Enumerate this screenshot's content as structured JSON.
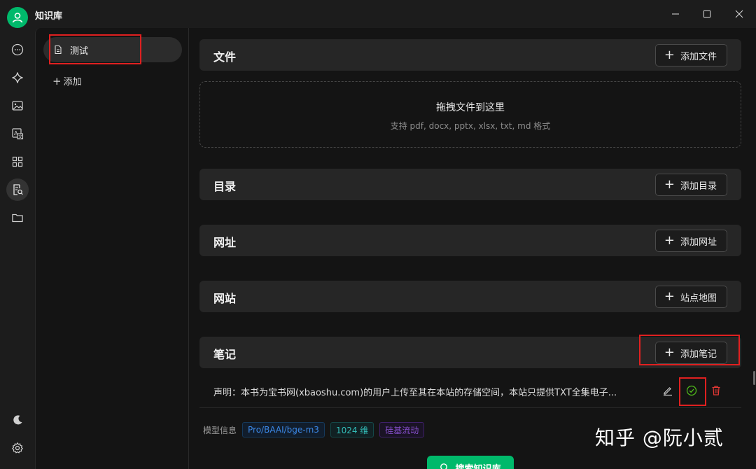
{
  "window": {
    "title": "知识库"
  },
  "rail": {
    "items": [
      {
        "name": "chat"
      },
      {
        "name": "agents"
      },
      {
        "name": "paintings"
      },
      {
        "name": "translate"
      },
      {
        "name": "apps"
      },
      {
        "name": "knowledge",
        "active": true
      },
      {
        "name": "files"
      }
    ]
  },
  "kb_list": {
    "items": [
      {
        "label": "测试",
        "selected": true
      }
    ],
    "add_label": "添加"
  },
  "sections": {
    "files": {
      "title": "文件",
      "button": "添加文件"
    },
    "directory": {
      "title": "目录",
      "button": "添加目录"
    },
    "url": {
      "title": "网址",
      "button": "添加网址"
    },
    "website": {
      "title": "网站",
      "button": "站点地图"
    },
    "notes": {
      "title": "笔记",
      "button": "添加笔记"
    }
  },
  "dropzone": {
    "title": "拖拽文件到这里",
    "subtitle": "支持 pdf, docx, pptx, xlsx, txt, md 格式"
  },
  "note_item": {
    "text": "声明：本书为宝书网(xbaoshu.com)的用户上传至其在本站的存储空间，本站只提供TXT全集电子..."
  },
  "model_info": {
    "label": "模型信息",
    "model": "Pro/BAAI/bge-m3",
    "dims": "1024 维",
    "provider": "硅基流动"
  },
  "search_button": "搜索知识库",
  "watermark": "知乎 @阮小贰",
  "colors": {
    "accent": "#00b96b",
    "highlight": "#e02020",
    "danger": "#e53935"
  }
}
